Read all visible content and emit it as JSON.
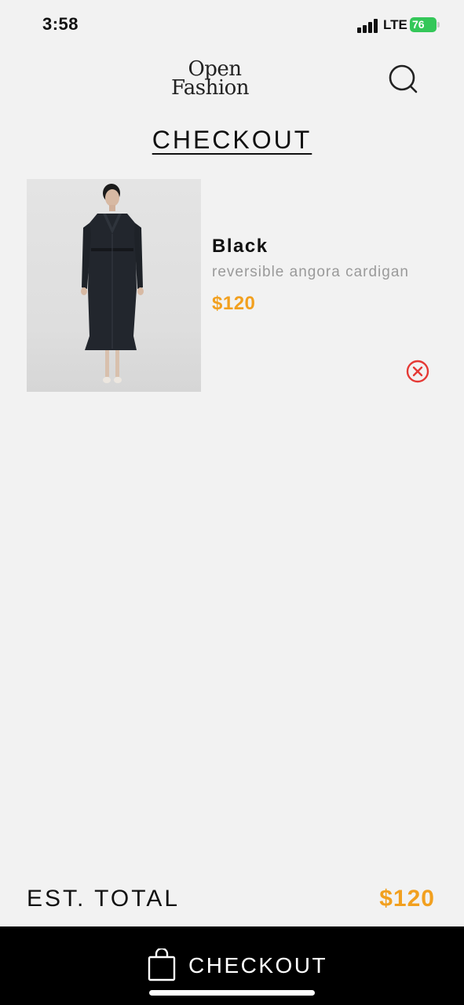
{
  "status_bar": {
    "time": "3:58",
    "network": "LTE",
    "battery": "76"
  },
  "header": {
    "brand_line_1": "Open",
    "brand_line_2": "Fashion",
    "search_icon": "search-icon"
  },
  "page": {
    "title": "CHECKOUT"
  },
  "cart": {
    "items": [
      {
        "color": "Black",
        "name": "reversible angora cardigan",
        "price": "$120",
        "image_icon": "product-photo",
        "remove_icon": "close-circle-icon"
      }
    ]
  },
  "summary": {
    "total_label": "EST. TOTAL",
    "total_value": "$120"
  },
  "checkout_bar": {
    "label": "CHECKOUT",
    "icon": "shopping-bag-icon"
  },
  "colors": {
    "accent": "#f2a01f",
    "remove": "#e53935",
    "background": "#f2f2f2",
    "bar": "#000000",
    "battery": "#34c759"
  }
}
